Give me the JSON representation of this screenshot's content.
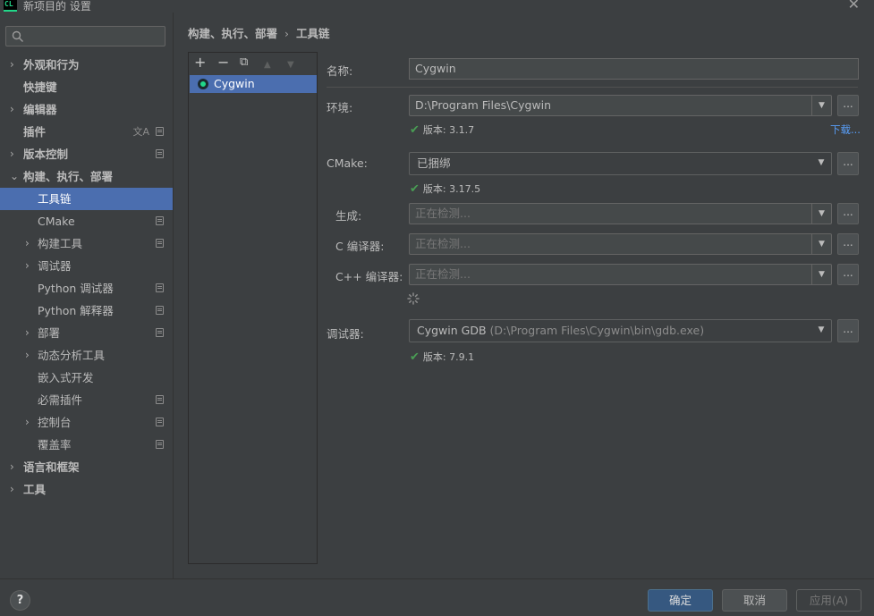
{
  "window": {
    "app_icon_text": "CL",
    "title": "新项目的 设置",
    "close_glyph": "✕"
  },
  "search": {
    "placeholder": "",
    "value": ""
  },
  "sidebar": {
    "items": [
      {
        "label": "外观和行为",
        "arrow": "›",
        "bold": true
      },
      {
        "label": "快捷键",
        "arrow": "",
        "bold": true
      },
      {
        "label": "编辑器",
        "arrow": "›",
        "bold": true
      },
      {
        "label": "插件",
        "arrow": "",
        "bold": true,
        "translate_icon": "文A"
      },
      {
        "label": "版本控制",
        "arrow": "›",
        "bold": true
      },
      {
        "label": "构建、执行、部署",
        "arrow": "⌄",
        "bold": true
      },
      {
        "label": "工具链",
        "selected": true
      },
      {
        "label": "CMake"
      },
      {
        "label": "构建工具",
        "arrow": "›"
      },
      {
        "label": "调试器",
        "arrow": "›"
      },
      {
        "label": "Python 调试器"
      },
      {
        "label": "Python 解释器"
      },
      {
        "label": "部署",
        "arrow": "›"
      },
      {
        "label": "动态分析工具",
        "arrow": "›"
      },
      {
        "label": "嵌入式开发"
      },
      {
        "label": "必需插件"
      },
      {
        "label": "控制台",
        "arrow": "›"
      },
      {
        "label": "覆盖率"
      },
      {
        "label": "语言和框架",
        "arrow": "›",
        "bold": true
      },
      {
        "label": "工具",
        "arrow": "›",
        "bold": true
      }
    ]
  },
  "breadcrumb": {
    "parent": "构建、执行、部署",
    "separator": "›",
    "current": "工具链"
  },
  "toolbar": {
    "add": "+",
    "remove": "−",
    "copy": "⧉",
    "up": "▲",
    "down": "▼"
  },
  "toolchains": [
    {
      "name": "Cygwin"
    }
  ],
  "form": {
    "name_label": "名称:",
    "name_value": "Cygwin",
    "env_label": "环境:",
    "env_value": "D:\\Program Files\\Cygwin",
    "env_version": "版本: 3.1.7",
    "download_link": "下载...",
    "cmake_label": "CMake:",
    "cmake_value": "已捆绑",
    "cmake_version": "版本: 3.17.5",
    "build_label": "生成:",
    "build_placeholder": "正在检测...",
    "c_compiler_label": "C 编译器:",
    "c_compiler_placeholder": "正在检测...",
    "cpp_compiler_label": "C++ 编译器:",
    "cpp_compiler_placeholder": "正在检测...",
    "debugger_label": "调试器:",
    "debugger_value": "Cygwin GDB",
    "debugger_path": "(D:\\Program Files\\Cygwin\\bin\\gdb.exe)",
    "debugger_version": "版本: 7.9.1",
    "browse": "...",
    "check_glyph": "✔",
    "dropdown_glyph": "▼"
  },
  "footer": {
    "help": "?",
    "ok": "确定",
    "cancel": "取消",
    "apply": "应用(A)"
  },
  "colors": {
    "background": "#3c3f41",
    "selection": "#4b6eaf",
    "primary_button": "#365880",
    "success": "#499c54",
    "link": "#589df6",
    "app_icon_accent": "#21d789"
  }
}
